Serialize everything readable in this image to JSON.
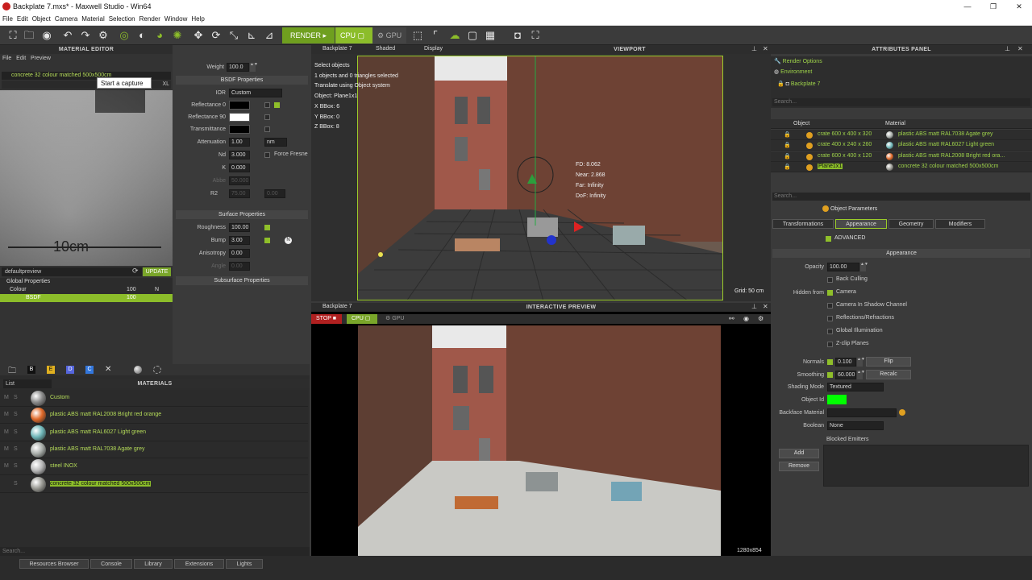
{
  "app": {
    "title": "Backplate 7.mxs* - Maxwell Studio  -  Win64",
    "window_buttons": [
      "—",
      "❐",
      "✕"
    ]
  },
  "menu": [
    "File",
    "Edit",
    "Object",
    "Camera",
    "Material",
    "Selection",
    "Render",
    "Window",
    "Help"
  ],
  "toolbar": {
    "render_label": "RENDER",
    "cpu_label": "CPU",
    "gpu_label": "GPU",
    "accent": "#8cbd2a"
  },
  "material_editor": {
    "title": "MATERIAL EDITOR",
    "menu": [
      "File",
      "Edit",
      "Preview"
    ],
    "material_name": "concrete 32 colour matched 500x500cm",
    "tooltip": "Start a capture",
    "preview_text": "10cm",
    "preview_size": "XL",
    "preview_scene": "defaultpreview",
    "update_label": "UPDATE",
    "tree": [
      {
        "name": "Global Properties",
        "v": "",
        "f": ""
      },
      {
        "name": "Colour",
        "v": "100",
        "f": "N"
      },
      {
        "name": "BSDF",
        "v": "100",
        "f": ""
      }
    ]
  },
  "bsdf": {
    "weight_label": "Weight",
    "weight": "100.0",
    "section": "BSDF Properties",
    "ior_label": "IOR",
    "ior_value": "Custom",
    "reflectance0_label": "Reflectance 0",
    "reflectance90_label": "Reflectance 90",
    "transmittance_label": "Transmittance",
    "attenuation_label": "Attenuation",
    "attenuation_value": "1.00",
    "attenuation_unit": "nm",
    "nd_label": "Nd",
    "nd_value": "3.000",
    "force_fresnel": "Force Fresne",
    "k_label": "K",
    "k_value": "0.000",
    "abbe_label": "Abbe",
    "abbe_value": "50.000",
    "r2_label": "R2",
    "r2_a": "75.00",
    "r2_b": "0.00",
    "surface_section": "Surface Properties",
    "roughness_label": "Roughness",
    "roughness_value": "100.00",
    "bump_label": "Bump",
    "bump_value": "3.00",
    "bump_flag": "N",
    "anisotropy_label": "Anisotropy",
    "anisotropy_value": "0.00",
    "angle_label": "Angle",
    "angle_value": "0.00",
    "subsurface_section": "Subsurface Properties"
  },
  "materials_panel": {
    "title": "MATERIALS",
    "icons": [
      "B",
      "E",
      "D",
      "C",
      "✕"
    ],
    "view_mode": "List",
    "items": [
      {
        "flags": [
          "M",
          "S"
        ],
        "name": "Custom",
        "ball": "#8a8a8a"
      },
      {
        "flags": [
          "M",
          "S"
        ],
        "name": "plastic ABS matt RAL2008 Bright red orange",
        "ball": "#e06a2a"
      },
      {
        "flags": [
          "M",
          "S"
        ],
        "name": "plastic ABS matt RAL6027 Light green",
        "ball": "#6fb7b9"
      },
      {
        "flags": [
          "M",
          "S"
        ],
        "name": "plastic ABS matt RAL7038 Agate grey",
        "ball": "#a9aeaa"
      },
      {
        "flags": [
          "M",
          "S"
        ],
        "name": "steel INOX",
        "ball": "#b8b8b8"
      },
      {
        "flags": [
          "",
          "S"
        ],
        "name": "concrete 32 colour matched 500x500cm",
        "ball": "#9a9a94"
      }
    ],
    "search_placeholder": "Search..."
  },
  "bottom_tabs": [
    "Resources Browser",
    "Console",
    "Library",
    "Extensions",
    "Lights"
  ],
  "viewport": {
    "title": "VIEWPORT",
    "camera": "Backplate 7",
    "shading": "Shaded",
    "display": "Display",
    "info": [
      "Select objects",
      "1 objects and 0 triangles selected",
      "Translate using Object system",
      "Object: Plane1x1",
      "X BBox: 6",
      "Y BBox: 0",
      "Z BBox: 8"
    ],
    "cam_info": [
      "FD: 8.062",
      "Near: 2.868",
      "Far: Infinity",
      "DoF: Infinity"
    ],
    "grid_label": "Grid: 50 cm"
  },
  "interactive_preview": {
    "title": "INTERACTIVE PREVIEW",
    "camera": "Backplate 7",
    "stop_label": "STOP",
    "cpu_label": "CPU",
    "gpu_label": "GPU",
    "resolution": "1280x854"
  },
  "attributes": {
    "title": "ATTRIBUTES PANEL",
    "render_options": "Render Options",
    "environment": "Environment",
    "camera_node": "Backplate 7",
    "search_placeholder": "Search...",
    "col_object": "Object",
    "col_material": "Material",
    "objects": [
      {
        "name": "crate 600 x 400 x 320",
        "material": "plastic ABS matt RAL7038 Agate grey",
        "mball": "#a9aeaa",
        "sel": false
      },
      {
        "name": "crate 400 x 240 x 260",
        "material": "plastic ABS matt RAL6027 Light green",
        "mball": "#6fb7b9",
        "sel": false
      },
      {
        "name": "crate 600 x 400 x 120",
        "material": "plastic ABS matt RAL2008 Bright red ora...",
        "mball": "#e06a2a",
        "sel": false
      },
      {
        "name": "Plane1x1",
        "material": "concrete 32 colour matched 500x500cm",
        "mball": "#9a9a94",
        "sel": true
      }
    ],
    "object_parameters": "Object Parameters",
    "tabs": [
      "Transformations",
      "Appearance",
      "Geometry",
      "Modifiers"
    ],
    "advanced_label": "ADVANCED",
    "appearance_section": "Appearance",
    "opacity_label": "Opacity",
    "opacity_value": "100.00",
    "back_culling": "Back Culling",
    "hidden_from": "Hidden from",
    "hidden_options": [
      "Camera",
      "Camera In Shadow Channel",
      "Reflections/Refractions",
      "Global Illumination",
      "Z-clip Planes"
    ],
    "normals_label": "Normals",
    "normals_value": "0.100",
    "flip_label": "Flip",
    "smoothing_label": "Smoothing",
    "smoothing_value": "60.000",
    "recalc_label": "Recalc",
    "shading_mode_label": "Shading Mode",
    "shading_mode_value": "Textured",
    "object_id_label": "Object Id",
    "object_id_color": "#00ff00",
    "backface_label": "Backface Material",
    "boolean_label": "Boolean",
    "boolean_value": "None",
    "blocked_emitters": "Blocked Emitters",
    "add_label": "Add",
    "remove_label": "Remove"
  }
}
